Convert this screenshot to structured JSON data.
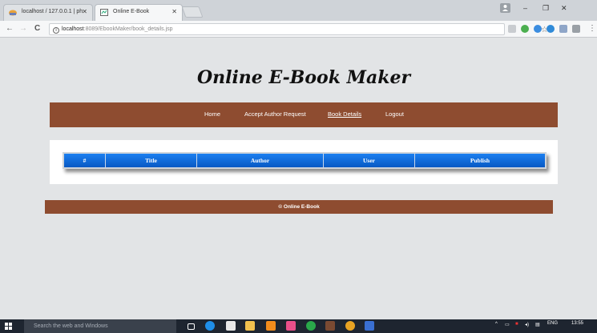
{
  "browser": {
    "tabs": [
      {
        "title": "localhost / 127.0.0.1 | ph"
      },
      {
        "title": "Online E-Book"
      }
    ],
    "url_host": "localhost",
    "url_path": ":8089/EbookMaker/book_details.jsp"
  },
  "site": {
    "title": "Online E-Book Maker",
    "nav": [
      {
        "label": "Home"
      },
      {
        "label": "Accept Author Request"
      },
      {
        "label": "Book Details"
      },
      {
        "label": "Logout"
      }
    ],
    "table_headers": [
      "#",
      "Title",
      "Author",
      "User",
      "Publish"
    ],
    "footer": "© Online E-Book"
  },
  "taskbar": {
    "search_placeholder": "Search the web and Windows",
    "lang": "ENG",
    "time": "13:55"
  },
  "colors": {
    "brand_brown": "#8e4c30",
    "table_header_blue": "#0d6fe0"
  }
}
